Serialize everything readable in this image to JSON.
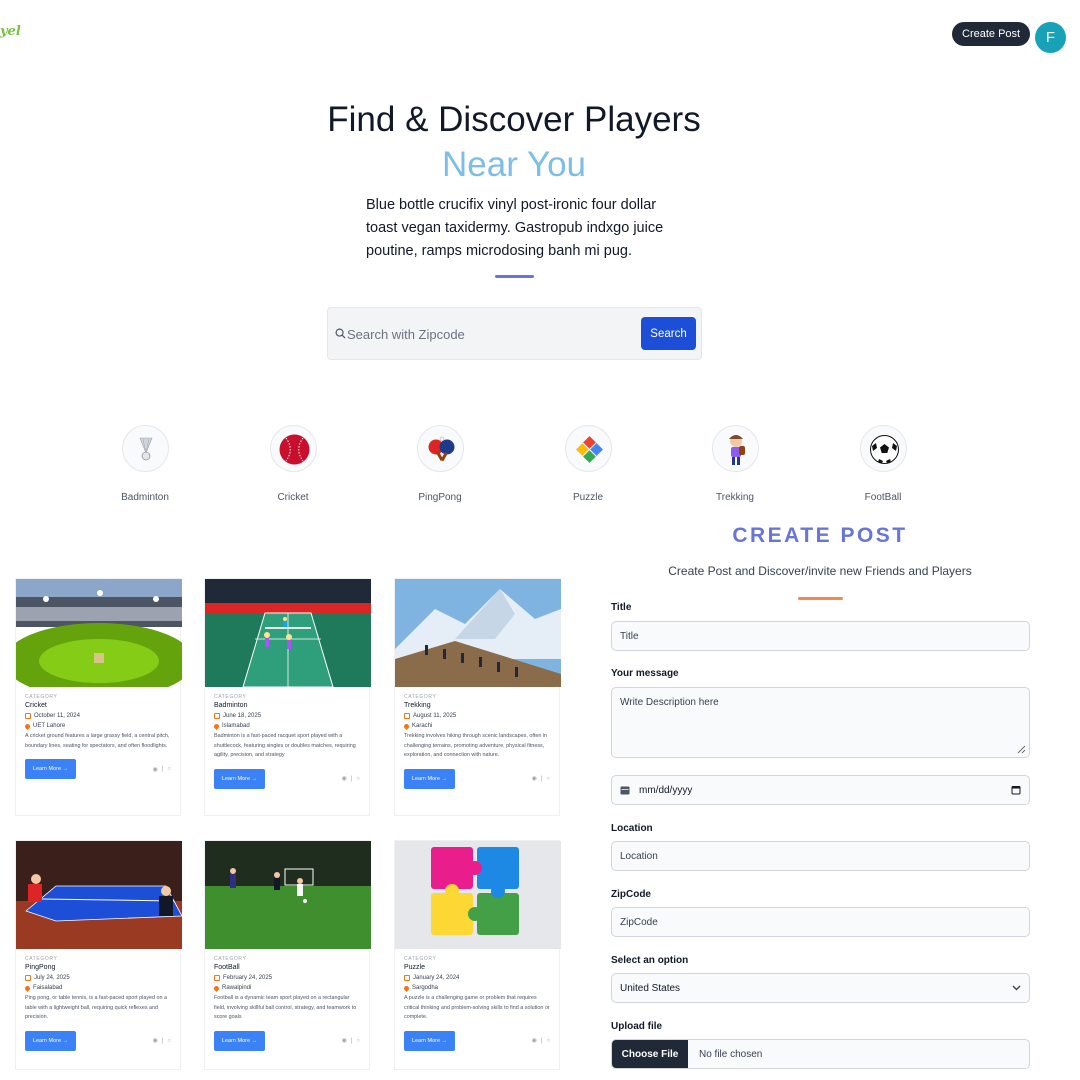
{
  "header": {
    "logo_text": "yel",
    "create_post_label": "Create Post",
    "avatar_initial": "F"
  },
  "hero": {
    "title": "Find & Discover Players",
    "accent": "Near You",
    "description": "Blue bottle crucifix vinyl post-ironic four dollar toast vegan taxidermy. Gastropub indxgo juice poutine, ramps microdosing banh mi pug."
  },
  "search": {
    "placeholder": "Search with Zipcode",
    "button_label": "Search"
  },
  "categories": [
    {
      "label": "Badminton",
      "icon": "shuttlecock-icon"
    },
    {
      "label": "Cricket",
      "icon": "cricket-ball-icon"
    },
    {
      "label": "PingPong",
      "icon": "ping-pong-paddles-icon"
    },
    {
      "label": "Puzzle",
      "icon": "puzzle-icon"
    },
    {
      "label": "Trekking",
      "icon": "hiker-icon"
    },
    {
      "label": "FootBall",
      "icon": "soccer-ball-icon"
    }
  ],
  "cards": [
    {
      "category": "CATEGORY",
      "title": "Cricket",
      "date": "October 11, 2024",
      "location": "UET Lahore",
      "description": "A cricket ground features a large grassy field, a central pitch, boundary lines, seating for spectators, and often floodlights.",
      "button_label": "Learn More →",
      "image": "cricket-stadium-image"
    },
    {
      "category": "CATEGORY",
      "title": "Badminton",
      "date": "June 18, 2025",
      "location": "Islamabad",
      "description": "Badminton is a fast-paced racquet sport played with a shuttlecock, featuring singles or doubles matches, requiring agility, precision, and strategy",
      "button_label": "Learn More →",
      "image": "badminton-court-image"
    },
    {
      "category": "CATEGORY",
      "title": "Trekking",
      "date": "August 11, 2025",
      "location": "Karachi",
      "description": "Trekking involves hiking through scenic landscapes, often in challenging terrains, promoting adventure, physical fitness, exploration, and connection with nature.",
      "button_label": "Learn More →",
      "image": "mountain-trek-image"
    },
    {
      "category": "CATEGORY",
      "title": "PingPong",
      "date": "July 24, 2025",
      "location": "Faisalabad",
      "description": "Ping pong, or table tennis, is a fast-paced sport played on a table with a lightweight ball, requiring quick reflexes and precision.",
      "button_label": "Learn More →",
      "image": "table-tennis-image"
    },
    {
      "category": "CATEGORY",
      "title": "FootBall",
      "date": "February 24, 2025",
      "location": "Rawalpindi",
      "description": "Football is a dynamic team sport played on a rectangular field, involving skillful ball control, strategy, and teamwork to score goals",
      "button_label": "Learn More →",
      "image": "football-pitch-image"
    },
    {
      "category": "CATEGORY",
      "title": "Puzzle",
      "date": "January 24, 2024",
      "location": "Sargodha",
      "description": "A puzzle is a challenging game or problem that requires critical thinking and problem-solving skills to find a solution or complete.",
      "button_label": "Learn More →",
      "image": "jigsaw-puzzle-image"
    }
  ],
  "create_post": {
    "heading": "CREATE POST",
    "subheading": "Create Post and Discover/invite new Friends and Players",
    "title_label": "Title",
    "title_placeholder": "Title",
    "message_label": "Your message",
    "message_placeholder": "Write Description here",
    "date_placeholder": "mm/dd/yyyy",
    "location_label": "Location",
    "location_placeholder": "Location",
    "zipcode_label": "ZipCode",
    "zipcode_placeholder": "ZipCode",
    "select_label": "Select an option",
    "select_value": "United States",
    "upload_label": "Upload file",
    "choose_file_label": "Choose File",
    "file_status": "No file chosen"
  },
  "colors": {
    "accent_blue": "#1d4ed8",
    "heading_purple": "#6875d8",
    "near_you_blue": "#7dbde6",
    "rule_orange": "#f28a4b",
    "avatar_teal": "#17a2b8"
  }
}
